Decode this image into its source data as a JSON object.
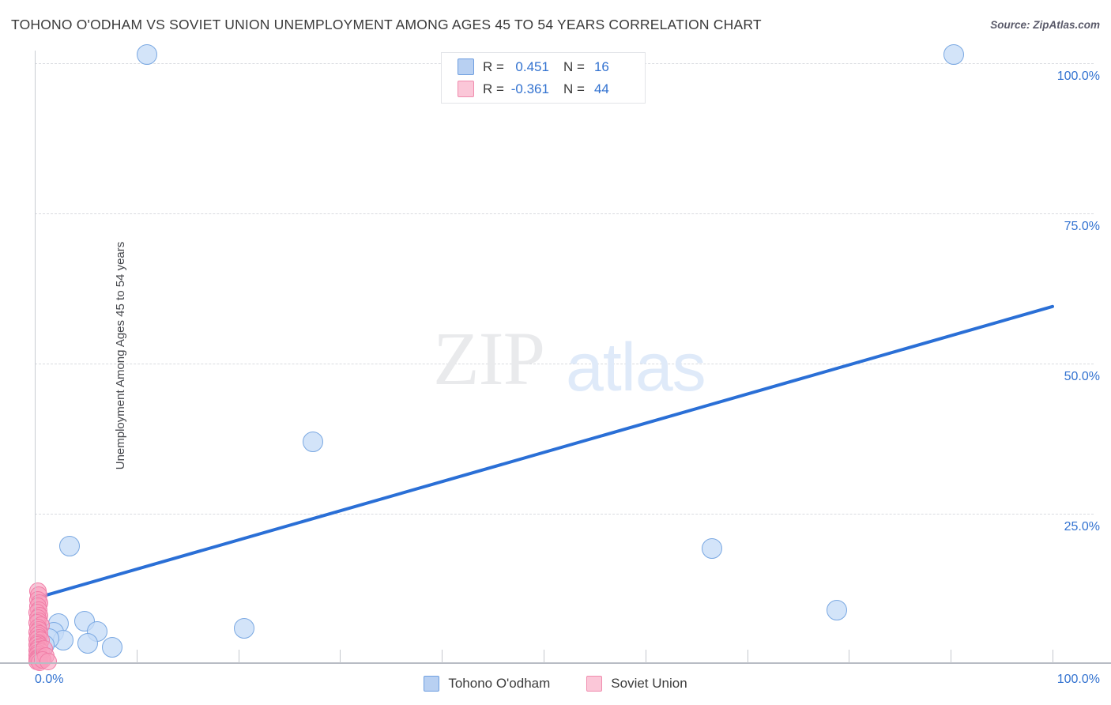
{
  "header": {
    "title": "TOHONO O'ODHAM VS SOVIET UNION UNEMPLOYMENT AMONG AGES 45 TO 54 YEARS CORRELATION CHART",
    "source": "Source: ZipAtlas.com"
  },
  "watermark": {
    "part1": "ZIP",
    "part2": "atlas"
  },
  "stats": {
    "rows": [
      {
        "r_label": "R =",
        "r_value": "0.451",
        "n_label": "N =",
        "n_value": "16",
        "color": "#b8d0f2"
      },
      {
        "r_label": "R =",
        "r_value": "-0.361",
        "n_label": "N =",
        "n_value": "44",
        "color": "#fbc7d8"
      }
    ]
  },
  "legend": {
    "items": [
      {
        "label": "Tohono O'odham",
        "color": "#b8d0f2",
        "border": "#6f9fe0"
      },
      {
        "label": "Soviet Union",
        "color": "#fbc7d8",
        "border": "#f08cae"
      }
    ]
  },
  "axes": {
    "y_title": "Unemployment Among Ages 45 to 54 years",
    "y_ticks": [
      "100.0%",
      "75.0%",
      "50.0%",
      "25.0%"
    ],
    "x_ticks": [
      "0.0%",
      "100.0%"
    ]
  },
  "chart_data": {
    "type": "scatter",
    "title": "TOHONO O'ODHAM VS SOVIET UNION UNEMPLOYMENT AMONG AGES 45 TO 54 YEARS CORRELATION CHART",
    "xlabel": "",
    "ylabel": "Unemployment Among Ages 45 to 54 years",
    "xlim": [
      0,
      100
    ],
    "ylim": [
      0,
      104
    ],
    "x_tick_values": [
      0,
      100
    ],
    "y_tick_values": [
      25,
      50,
      75,
      100
    ],
    "grid": true,
    "legend_position": "bottom-center",
    "trendlines": [
      {
        "series": "Tohono O'odham",
        "color": "#2a6fd6",
        "x0": 0.2,
        "y0": 11.0,
        "x1": 100.0,
        "y1": 59.5
      }
    ],
    "series": [
      {
        "name": "Tohono O'odham",
        "color": "#b8d0f2",
        "r": 0.451,
        "n": 16,
        "points": [
          [
            11.0,
            101.5
          ],
          [
            90.3,
            101.5
          ],
          [
            27.3,
            37.0
          ],
          [
            3.4,
            19.6
          ],
          [
            66.5,
            19.2
          ],
          [
            78.8,
            9.0
          ],
          [
            20.6,
            5.9
          ],
          [
            4.9,
            7.1
          ],
          [
            2.3,
            6.7
          ],
          [
            1.9,
            5.2
          ],
          [
            6.1,
            5.4
          ],
          [
            2.8,
            3.9
          ],
          [
            5.2,
            3.4
          ],
          [
            7.6,
            2.8
          ],
          [
            1.4,
            4.2
          ],
          [
            0.9,
            3.1
          ]
        ]
      },
      {
        "name": "Soviet Union",
        "color": "#fbc7d8",
        "r": -0.361,
        "n": 44,
        "points": [
          [
            0.3,
            12.1
          ],
          [
            0.4,
            11.4
          ],
          [
            0.3,
            10.7
          ],
          [
            0.5,
            10.1
          ],
          [
            0.3,
            9.6
          ],
          [
            0.4,
            9.0
          ],
          [
            0.2,
            8.5
          ],
          [
            0.5,
            8.0
          ],
          [
            0.3,
            7.6
          ],
          [
            0.4,
            7.1
          ],
          [
            0.2,
            6.8
          ],
          [
            0.6,
            6.4
          ],
          [
            0.3,
            6.0
          ],
          [
            0.4,
            5.7
          ],
          [
            0.2,
            5.3
          ],
          [
            0.5,
            5.0
          ],
          [
            0.3,
            4.7
          ],
          [
            0.4,
            4.4
          ],
          [
            0.2,
            4.1
          ],
          [
            0.6,
            3.9
          ],
          [
            0.3,
            3.6
          ],
          [
            0.4,
            3.3
          ],
          [
            0.2,
            3.1
          ],
          [
            0.5,
            2.9
          ],
          [
            0.3,
            2.6
          ],
          [
            0.4,
            2.4
          ],
          [
            0.2,
            2.2
          ],
          [
            0.6,
            2.0
          ],
          [
            0.3,
            1.8
          ],
          [
            0.4,
            1.6
          ],
          [
            0.2,
            1.4
          ],
          [
            0.5,
            1.2
          ],
          [
            0.3,
            1.1
          ],
          [
            0.4,
            0.9
          ],
          [
            0.2,
            0.8
          ],
          [
            0.6,
            0.7
          ],
          [
            0.3,
            0.6
          ],
          [
            0.4,
            0.5
          ],
          [
            0.2,
            0.4
          ],
          [
            0.5,
            0.3
          ],
          [
            0.9,
            2.5
          ],
          [
            1.1,
            1.3
          ],
          [
            0.8,
            0.6
          ],
          [
            1.3,
            0.4
          ]
        ]
      }
    ]
  }
}
